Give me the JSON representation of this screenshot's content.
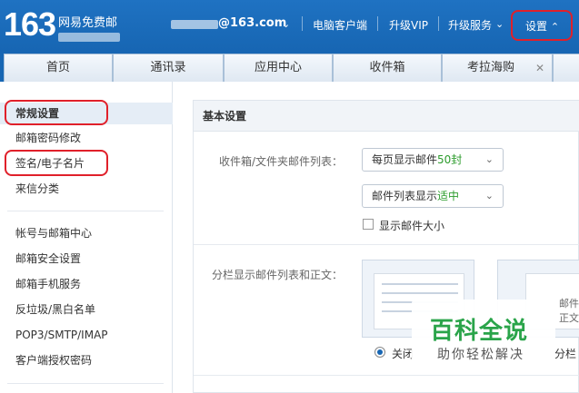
{
  "header": {
    "logo_number": "163",
    "logo_subtitle": "网易免费邮",
    "account_email": "@163.com",
    "links": [
      "电脑客户端",
      "升级VIP",
      "升级服务"
    ],
    "settings_label": "设置"
  },
  "tabs": [
    {
      "label": "首页"
    },
    {
      "label": "通讯录"
    },
    {
      "label": "应用中心"
    },
    {
      "label": "收件箱"
    },
    {
      "label": "考拉海购"
    }
  ],
  "sidebar": {
    "group1": [
      "常规设置",
      "邮箱密码修改",
      "签名/电子名片",
      "来信分类"
    ],
    "group2": [
      "帐号与邮箱中心",
      "邮箱安全设置",
      "邮箱手机服务",
      "反垃圾/黑白名单",
      "POP3/SMTP/IMAP",
      "客户端授权密码"
    ]
  },
  "main": {
    "section_title": "基本设置",
    "list_label": "收件箱/文件夹邮件列表：",
    "per_page_prefix": "每页显示邮件",
    "per_page_value": "50封",
    "display_prefix": "邮件列表显示",
    "display_value": "适中",
    "show_size_label": "显示邮件大小",
    "split_label": "分栏显示邮件列表和正文：",
    "preview_right_fragment": "邮件正文",
    "radio_off_label": "关闭",
    "radio_right_fragment": "分栏"
  },
  "watermark": {
    "title": "百科全说",
    "subtitle": "助你轻松解决"
  },
  "colors": {
    "header_blue": "#1766b3",
    "highlight_red": "#e0202a",
    "accent_green": "#2d9c2d"
  }
}
